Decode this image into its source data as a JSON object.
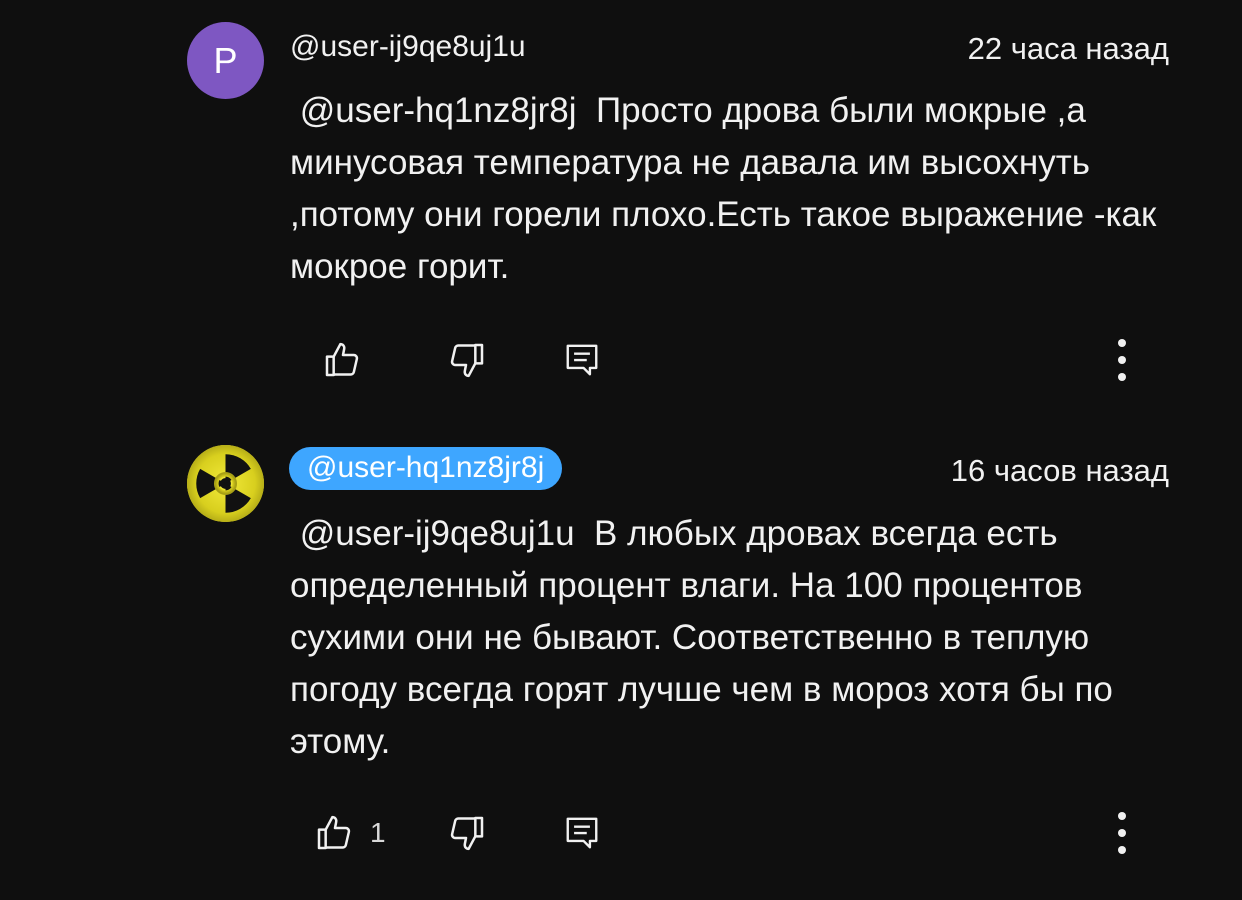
{
  "comments": [
    {
      "avatar_letter": "P",
      "avatar_color": "#7e57c2",
      "author": "@user-ij9qe8uj1u",
      "author_highlighted": false,
      "time": "22 часа назад",
      "mention": "@user-hq1nz8jr8j",
      "text": "Просто дрова были мокрые ,а минусовая температура не давала им высохнуть ,потому они горели плохо.Есть такое выражение -как мокрое горит.",
      "like_count": "",
      "icons": [
        "thumb-up-icon",
        "thumb-down-icon",
        "reply-icon",
        "more-vert-icon"
      ]
    },
    {
      "avatar_icon": "radiation-icon",
      "author": "@user-hq1nz8jr8j",
      "author_highlighted": true,
      "author_highlight_color": "#3ea6ff",
      "time": "16 часов назад",
      "mention": "@user-ij9qe8uj1u",
      "text": "В любых дровах всегда есть определенный процент влаги. На 100 процентов сухими они не бывают. Соответственно в теплую погоду всегда горят лучше чем в мороз хотя бы по этому.",
      "like_count": "1",
      "icons": [
        "thumb-up-icon",
        "thumb-down-icon",
        "reply-icon",
        "more-vert-icon"
      ]
    }
  ],
  "theme": {
    "background": "#0f0f0f",
    "text": "#f1f1f1",
    "accent": "#3ea6ff"
  }
}
